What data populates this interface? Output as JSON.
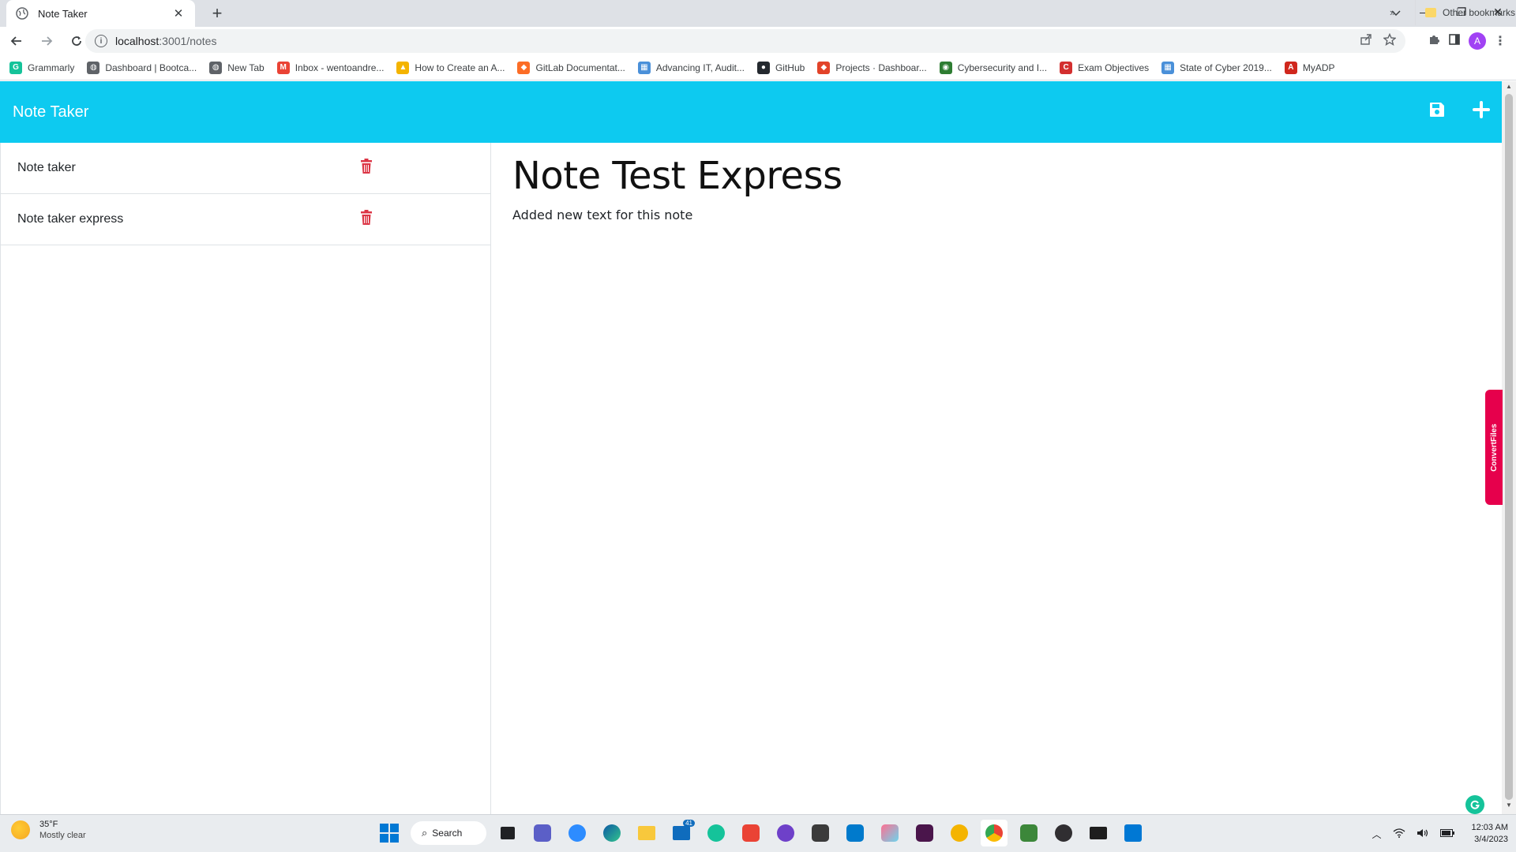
{
  "browser": {
    "tab_title": "Note Taker",
    "tab_close": "✕",
    "new_tab": "+",
    "url_host": "localhost",
    "url_path": ":3001/notes",
    "avatar_letter": "A",
    "window_controls": {
      "chevron": "⌄",
      "minimize": "—",
      "restore": "❐",
      "close": "✕"
    }
  },
  "bookmarks": [
    {
      "label": "Grammarly",
      "color": "#15c39a",
      "glyph": "G"
    },
    {
      "label": "Dashboard | Bootca...",
      "color": "#5f6368",
      "glyph": "◍"
    },
    {
      "label": "New Tab",
      "color": "#5f6368",
      "glyph": "◍"
    },
    {
      "label": "Inbox - wentoandre...",
      "color": "#ea4335",
      "glyph": "M"
    },
    {
      "label": "How to Create an A...",
      "color": "#f4b400",
      "glyph": "▲"
    },
    {
      "label": "GitLab Documentat...",
      "color": "#fc6d26",
      "glyph": "◆"
    },
    {
      "label": "Advancing IT, Audit...",
      "color": "#4a90d9",
      "glyph": "▦"
    },
    {
      "label": "GitHub",
      "color": "#24292f",
      "glyph": "●"
    },
    {
      "label": "Projects · Dashboar...",
      "color": "#e24329",
      "glyph": "◆"
    },
    {
      "label": "Cybersecurity and I...",
      "color": "#2e7d32",
      "glyph": "◉"
    },
    {
      "label": "Exam Objectives",
      "color": "#d32f2f",
      "glyph": "C"
    },
    {
      "label": "State of Cyber 2019...",
      "color": "#4a90d9",
      "glyph": "▦"
    },
    {
      "label": "MyADP",
      "color": "#d0271d",
      "glyph": "A"
    }
  ],
  "bookmarks_more": "»",
  "other_bookmarks": "Other bookmarks",
  "app": {
    "brand": "Note Taker",
    "notes": [
      {
        "title": "Note taker"
      },
      {
        "title": "Note taker express"
      }
    ],
    "active_note": {
      "title": "Note Test Express",
      "text": "Added new text for this note"
    },
    "colors": {
      "navbar": "#0dcaf0",
      "delete": "#dc3545"
    }
  },
  "extension_tab": "ConvertFiles",
  "taskbar": {
    "weather_temp": "35°F",
    "weather_condition": "Mostly clear",
    "search_label": "Search",
    "mail_badge": "41",
    "time": "12:03 AM",
    "date": "3/4/2023"
  }
}
